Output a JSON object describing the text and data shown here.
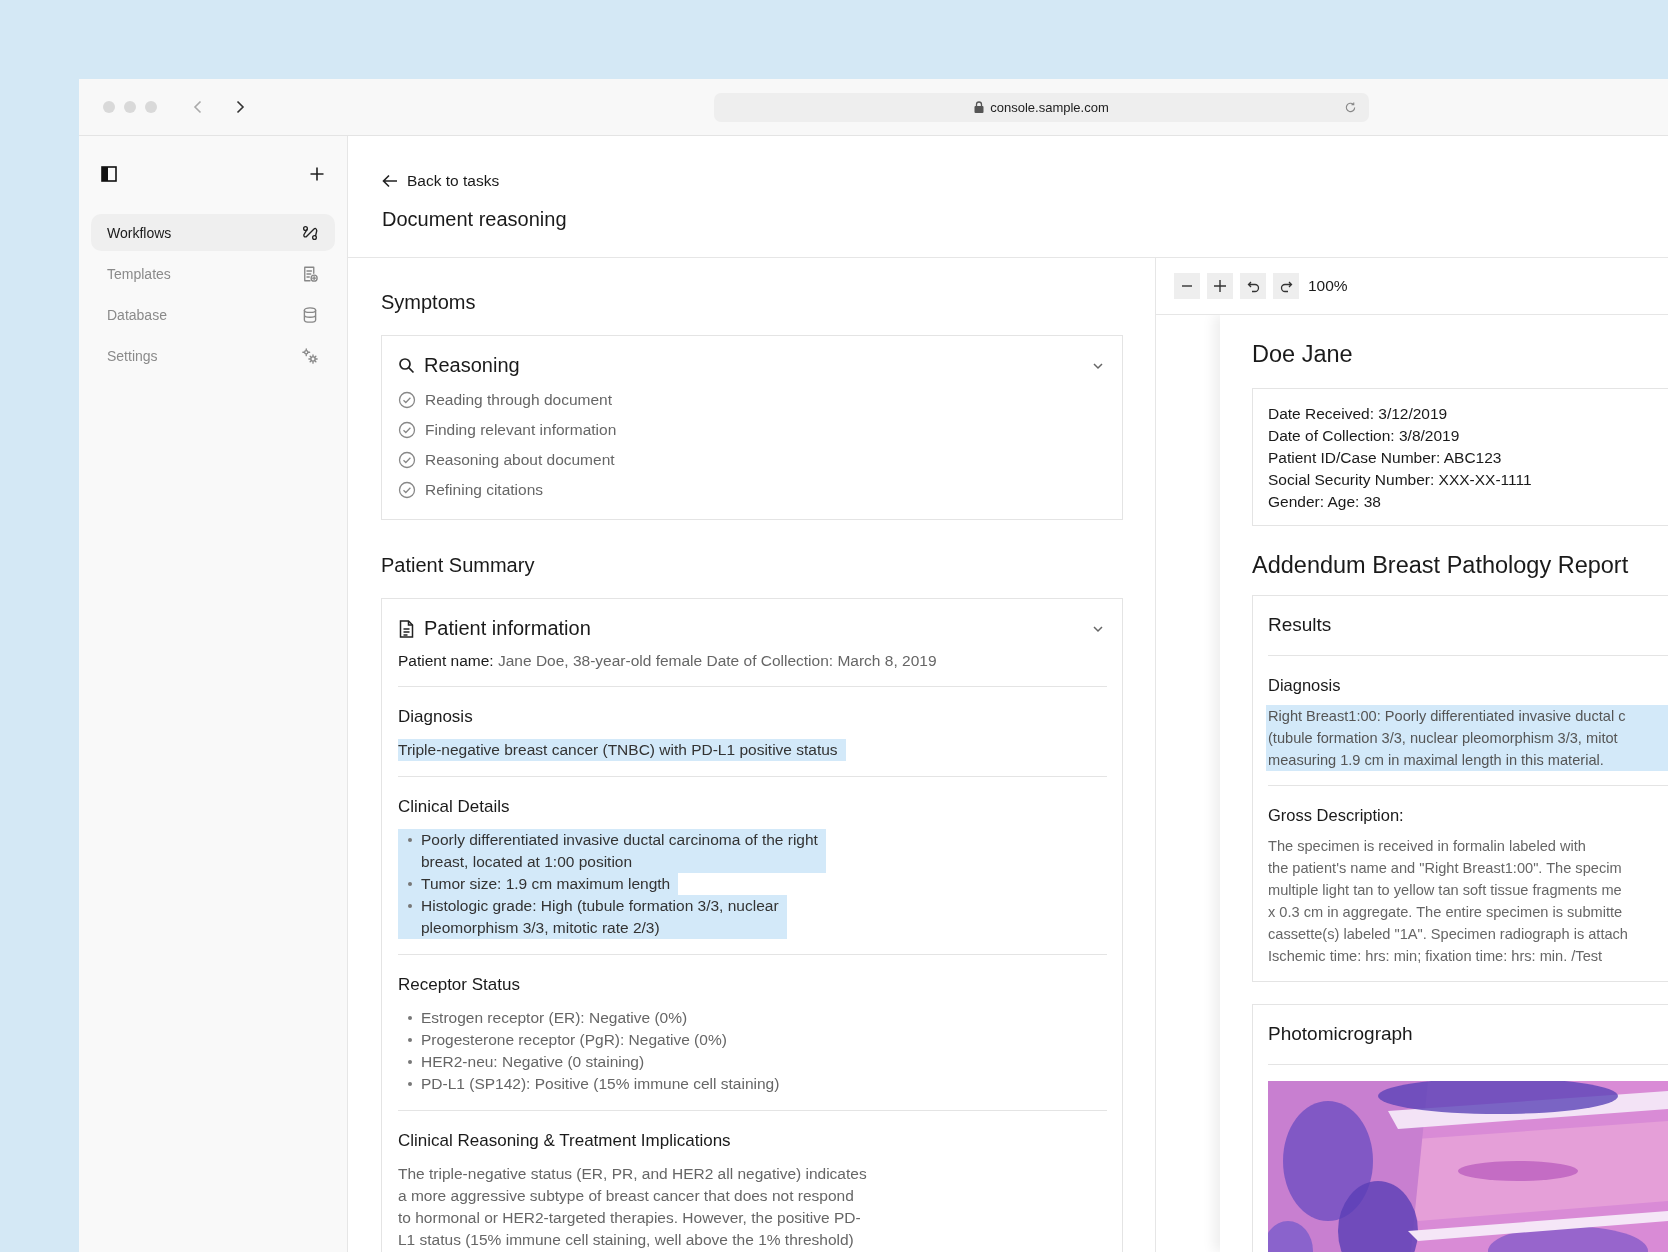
{
  "browser": {
    "url": "console.sample.com"
  },
  "sidebar": {
    "items": [
      {
        "label": "Workflows",
        "selected": true,
        "kind": "workflows"
      },
      {
        "label": "Templates",
        "selected": false,
        "kind": "templates"
      },
      {
        "label": "Database",
        "selected": false,
        "kind": "database"
      },
      {
        "label": "Settings",
        "selected": false,
        "kind": "settings"
      }
    ]
  },
  "header": {
    "back_link": "Back to tasks",
    "title": "Document reasoning"
  },
  "symptoms": {
    "heading": "Symptoms",
    "card": {
      "title": "Reasoning",
      "expanded": true,
      "steps": [
        {
          "label": "Reading through document",
          "done": true
        },
        {
          "label": "Finding relevant information",
          "done": true
        },
        {
          "label": "Reasoning about document",
          "done": true
        },
        {
          "label": "Refining citations",
          "done": true
        }
      ]
    }
  },
  "patient_summary": {
    "heading": "Patient Summary",
    "card": {
      "title": "Patient information",
      "expanded": true,
      "patient_line": "**Patient name:** Jane Doe, 38-year-old female Date of Collection: March 8, 2019",
      "sections": [
        {
          "title": "Diagnosis",
          "kind": "text",
          "items": [
            {
              "lines": [
                "Triple-negative breast cancer (TNBC) with PD-L1 positive status"
              ],
              "highlighted": true
            }
          ]
        },
        {
          "title": "Clinical Details",
          "kind": "list",
          "items": [
            {
              "lines": [
                "Poorly differentiated invasive ductal carcinoma of the right",
                "breast, located at 1:00 position"
              ],
              "highlighted": true
            },
            {
              "lines": [
                "Tumor size: 1.9 cm maximum length"
              ],
              "highlighted": true
            },
            {
              "lines": [
                "Histologic grade: High (tubule formation 3/3, nuclear",
                "pleomorphism 3/3, mitotic rate 2/3)"
              ],
              "highlighted": true
            }
          ]
        },
        {
          "title": "Receptor Status",
          "kind": "list",
          "items": [
            {
              "lines": [
                "Estrogen receptor (ER): Negative (0%)"
              ],
              "highlighted": false
            },
            {
              "lines": [
                "Progesterone receptor (PgR): Negative (0%)"
              ],
              "highlighted": false
            },
            {
              "lines": [
                "HER2-neu: Negative (0 staining)"
              ],
              "highlighted": false
            },
            {
              "lines": [
                "PD-L1 (SP142): Positive (15% immune cell staining)"
              ],
              "highlighted": false
            }
          ]
        },
        {
          "title": "Clinical Reasoning & Treatment Implications",
          "kind": "paragraph",
          "items": [
            {
              "lines": [
                "The triple-negative status (ER, PR, and HER2 all negative) indicates",
                "a more aggressive subtype of breast cancer that does not respond",
                "to hormonal or HER2-targeted therapies. However, the positive PD-",
                "L1 status (15% immune cell staining, well above the 1% threshold)"
              ],
              "highlighted": false
            }
          ]
        }
      ]
    }
  },
  "viewer": {
    "zoom": "100%",
    "document": {
      "title": "Doe Jane",
      "info_lines": [
        "Date Received: 3/12/2019",
        "Date of Collection: 3/8/2019",
        "Patient ID/Case Number: ABC123",
        "Social Security Number: XXX-XX-1111",
        "Gender: Age: 38"
      ],
      "report_title": "Addendum Breast Pathology Report",
      "results": {
        "heading": "Results",
        "sections": [
          {
            "title": "Diagnosis",
            "highlighted": true,
            "lines": [
              "Right Breast1:00: Poorly differentiated invasive ductal c",
              "(tubule formation 3/3, nuclear pleomorphism 3/3, mitot",
              "measuring 1.9 cm in maximal length in this material."
            ]
          },
          {
            "title": "Gross Description:",
            "highlighted": false,
            "lines": [
              "The specimen is received in formalin labeled with",
              "the patient's name and \"Right Breast1:00\". The specim",
              "multiple light tan to yellow tan soft tissue fragments me",
              "x 0.3 cm in aggregate. The entire specimen is submitte",
              "cassette(s) labeled \"1A\". Specimen radiograph is attach",
              "Ischemic time: hrs: min; fixation time: hrs: min. /Test"
            ]
          }
        ]
      },
      "photo": {
        "heading": "Photomicrograph",
        "kind": "picture"
      }
    }
  }
}
